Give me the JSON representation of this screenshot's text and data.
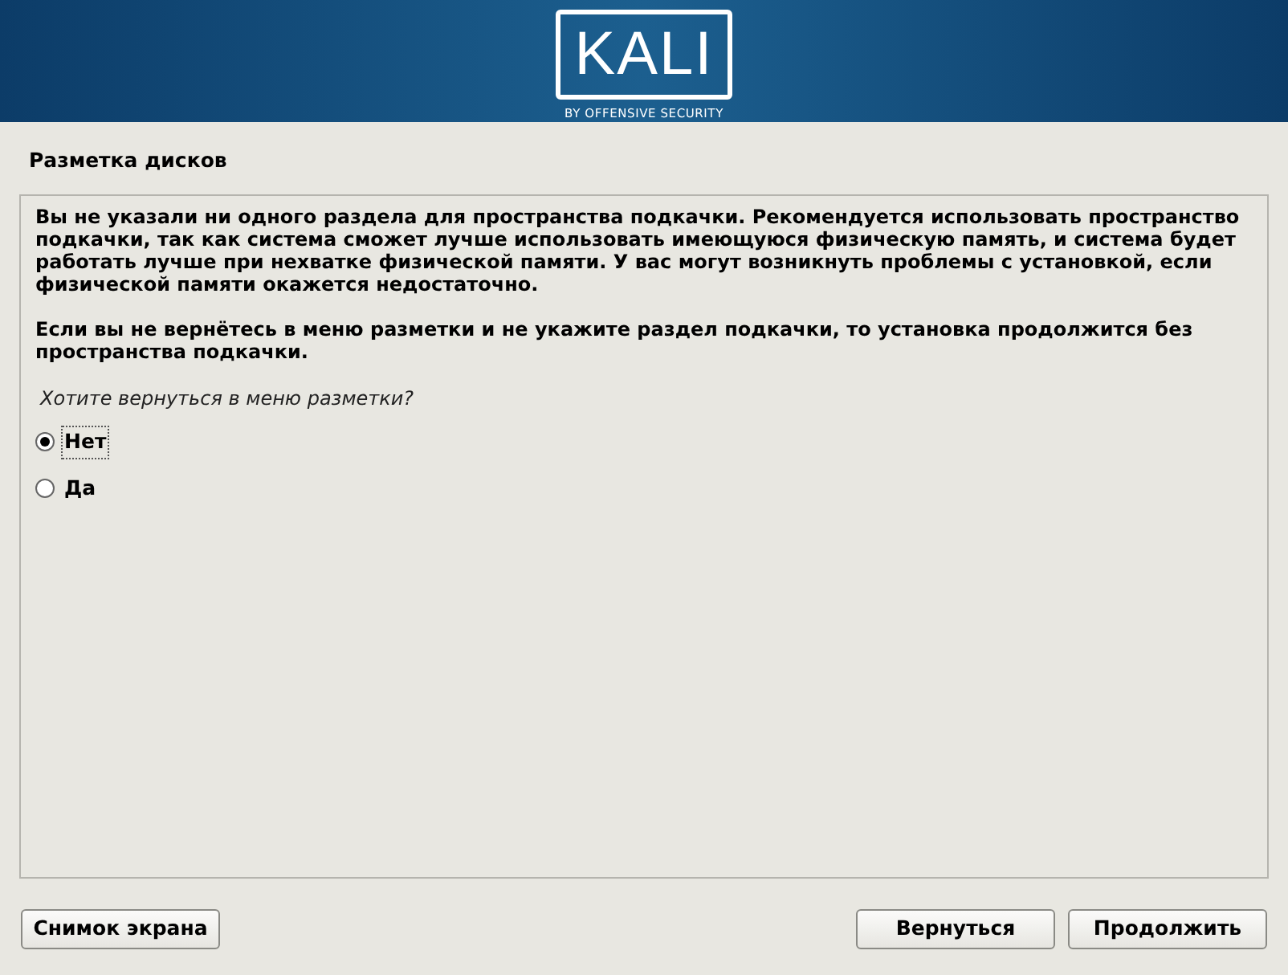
{
  "header": {
    "logo_text": "KALI",
    "tagline": "BY OFFENSIVE SECURITY"
  },
  "title": "Разметка дисков",
  "paragraphs": [
    "Вы не указали ни одного раздела для пространства подкачки. Рекомендуется использовать пространство подкачки, так как система сможет лучше использовать имеющуюся физическую память, и система будет работать лучше при нехватке физической памяти. У вас могут возникнуть проблемы с установкой, если физической памяти окажется недостаточно.",
    "Если вы не вернётесь в меню разметки и не укажите раздел подкачки, то установка продолжится без пространства подкачки."
  ],
  "question": "Хотите вернуться в меню разметки?",
  "options": [
    {
      "label": "Нет",
      "selected": true
    },
    {
      "label": "Да",
      "selected": false
    }
  ],
  "buttons_left": [
    "Снимок экрана"
  ],
  "buttons_right": [
    "Вернуться",
    "Продолжить"
  ]
}
